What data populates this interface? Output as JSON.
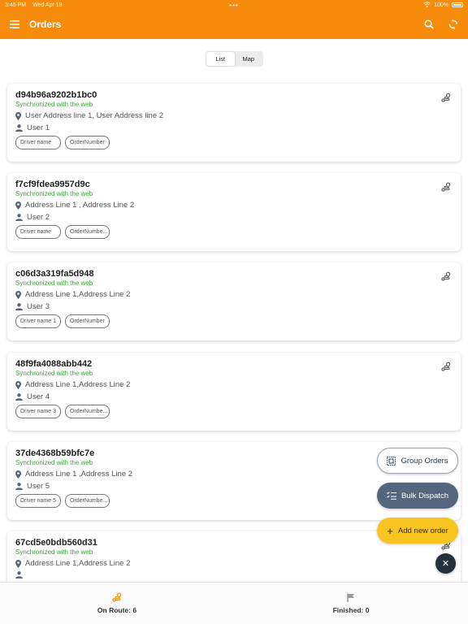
{
  "status_bar": {
    "time": "3:45 PM",
    "date": "Wed Apr 19",
    "battery": "100%"
  },
  "header": {
    "title": "Orders"
  },
  "view_toggle": {
    "options": [
      "List",
      "Map"
    ],
    "selected": "List"
  },
  "orders": [
    {
      "id": "d94b96a9202b1bc0",
      "sync": "Synchronized with the web",
      "address": "User Address line 1, User Address line 2",
      "user": "User 1",
      "driver": "Driver name",
      "order_number": "OrderNumber"
    },
    {
      "id": "f7cf9fdea9957d9c",
      "sync": "Synchronized with the web",
      "address": "Address Line 1 , Address Line 2",
      "user": "User 2",
      "driver": "Driver name",
      "order_number": "OrderNumbe..."
    },
    {
      "id": "c06d3a319fa5d948",
      "sync": "Synchronized with the web",
      "address": "Address Line 1,Address Line 2",
      "user": "User 3",
      "driver": "Driver name 1",
      "order_number": "OrderNumber"
    },
    {
      "id": "48f9fa4088abb442",
      "sync": "Synchronized with the web",
      "address": "Address Line 1,Address Line 2",
      "user": "User 4",
      "driver": "Driver name 3",
      "order_number": "OrderNumbe..."
    },
    {
      "id": "37de4368b59bfc7e",
      "sync": "Synchronized with the web",
      "address": "Address Line 1 ,Address Line 2",
      "user": "User 5",
      "driver": "Driver name 5",
      "order_number": "OrderNumbe..."
    },
    {
      "id": "67cd5e0bdb560d31",
      "sync": "Synchronized with the web",
      "address": "Address Line 1,Address Line 2",
      "user": "",
      "driver": "",
      "order_number": ""
    }
  ],
  "fab_menu": {
    "group": "Group Orders",
    "bulk": "Bulk Dispatch",
    "add": "Add new order"
  },
  "bottom_tabs": [
    {
      "label": "On Route: 6",
      "icon": "route-icon"
    },
    {
      "label": "Finished: 0",
      "icon": "flag-icon"
    }
  ],
  "colors": {
    "primary": "#f68b0c",
    "sync_green": "#39a935",
    "bulk": "#53667e",
    "add": "#f7c420",
    "close": "#24303d"
  }
}
